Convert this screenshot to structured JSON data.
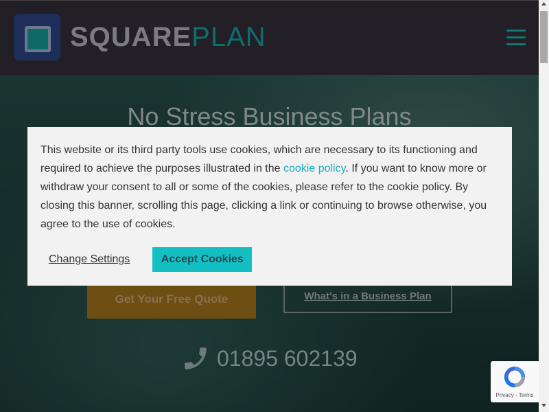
{
  "header": {
    "logo_bold": "SQUARE",
    "logo_light": "PLAN",
    "menu_icon": "hamburger-menu-icon"
  },
  "hero": {
    "title": "No Stress Business Plans",
    "quote_button": "Get Your Free Quote",
    "whats_button": "What's in a Business Plan",
    "phone_icon": "phone-icon",
    "phone_number": "01895 602139"
  },
  "cookie_banner": {
    "text_before_link": "This website or its third party tools use cookies, which are necessary to its functioning and required to achieve the purposes illustrated in the ",
    "link_text": "cookie policy",
    "text_after_link": ". If you want to know more or withdraw your consent to all or some of the cookies, please refer to the cookie policy. By closing this banner, scrolling this page, clicking a link or continuing to browse otherwise, you agree to the use of cookies.",
    "change_settings": "Change Settings",
    "accept": "Accept Cookies"
  },
  "recaptcha": {
    "links": "Privacy - Terms"
  },
  "colors": {
    "accent": "#14bfc4",
    "header_bg": "#221f26",
    "brand_teal": "#0b6f6d",
    "quote_button": "#6e4e12"
  }
}
